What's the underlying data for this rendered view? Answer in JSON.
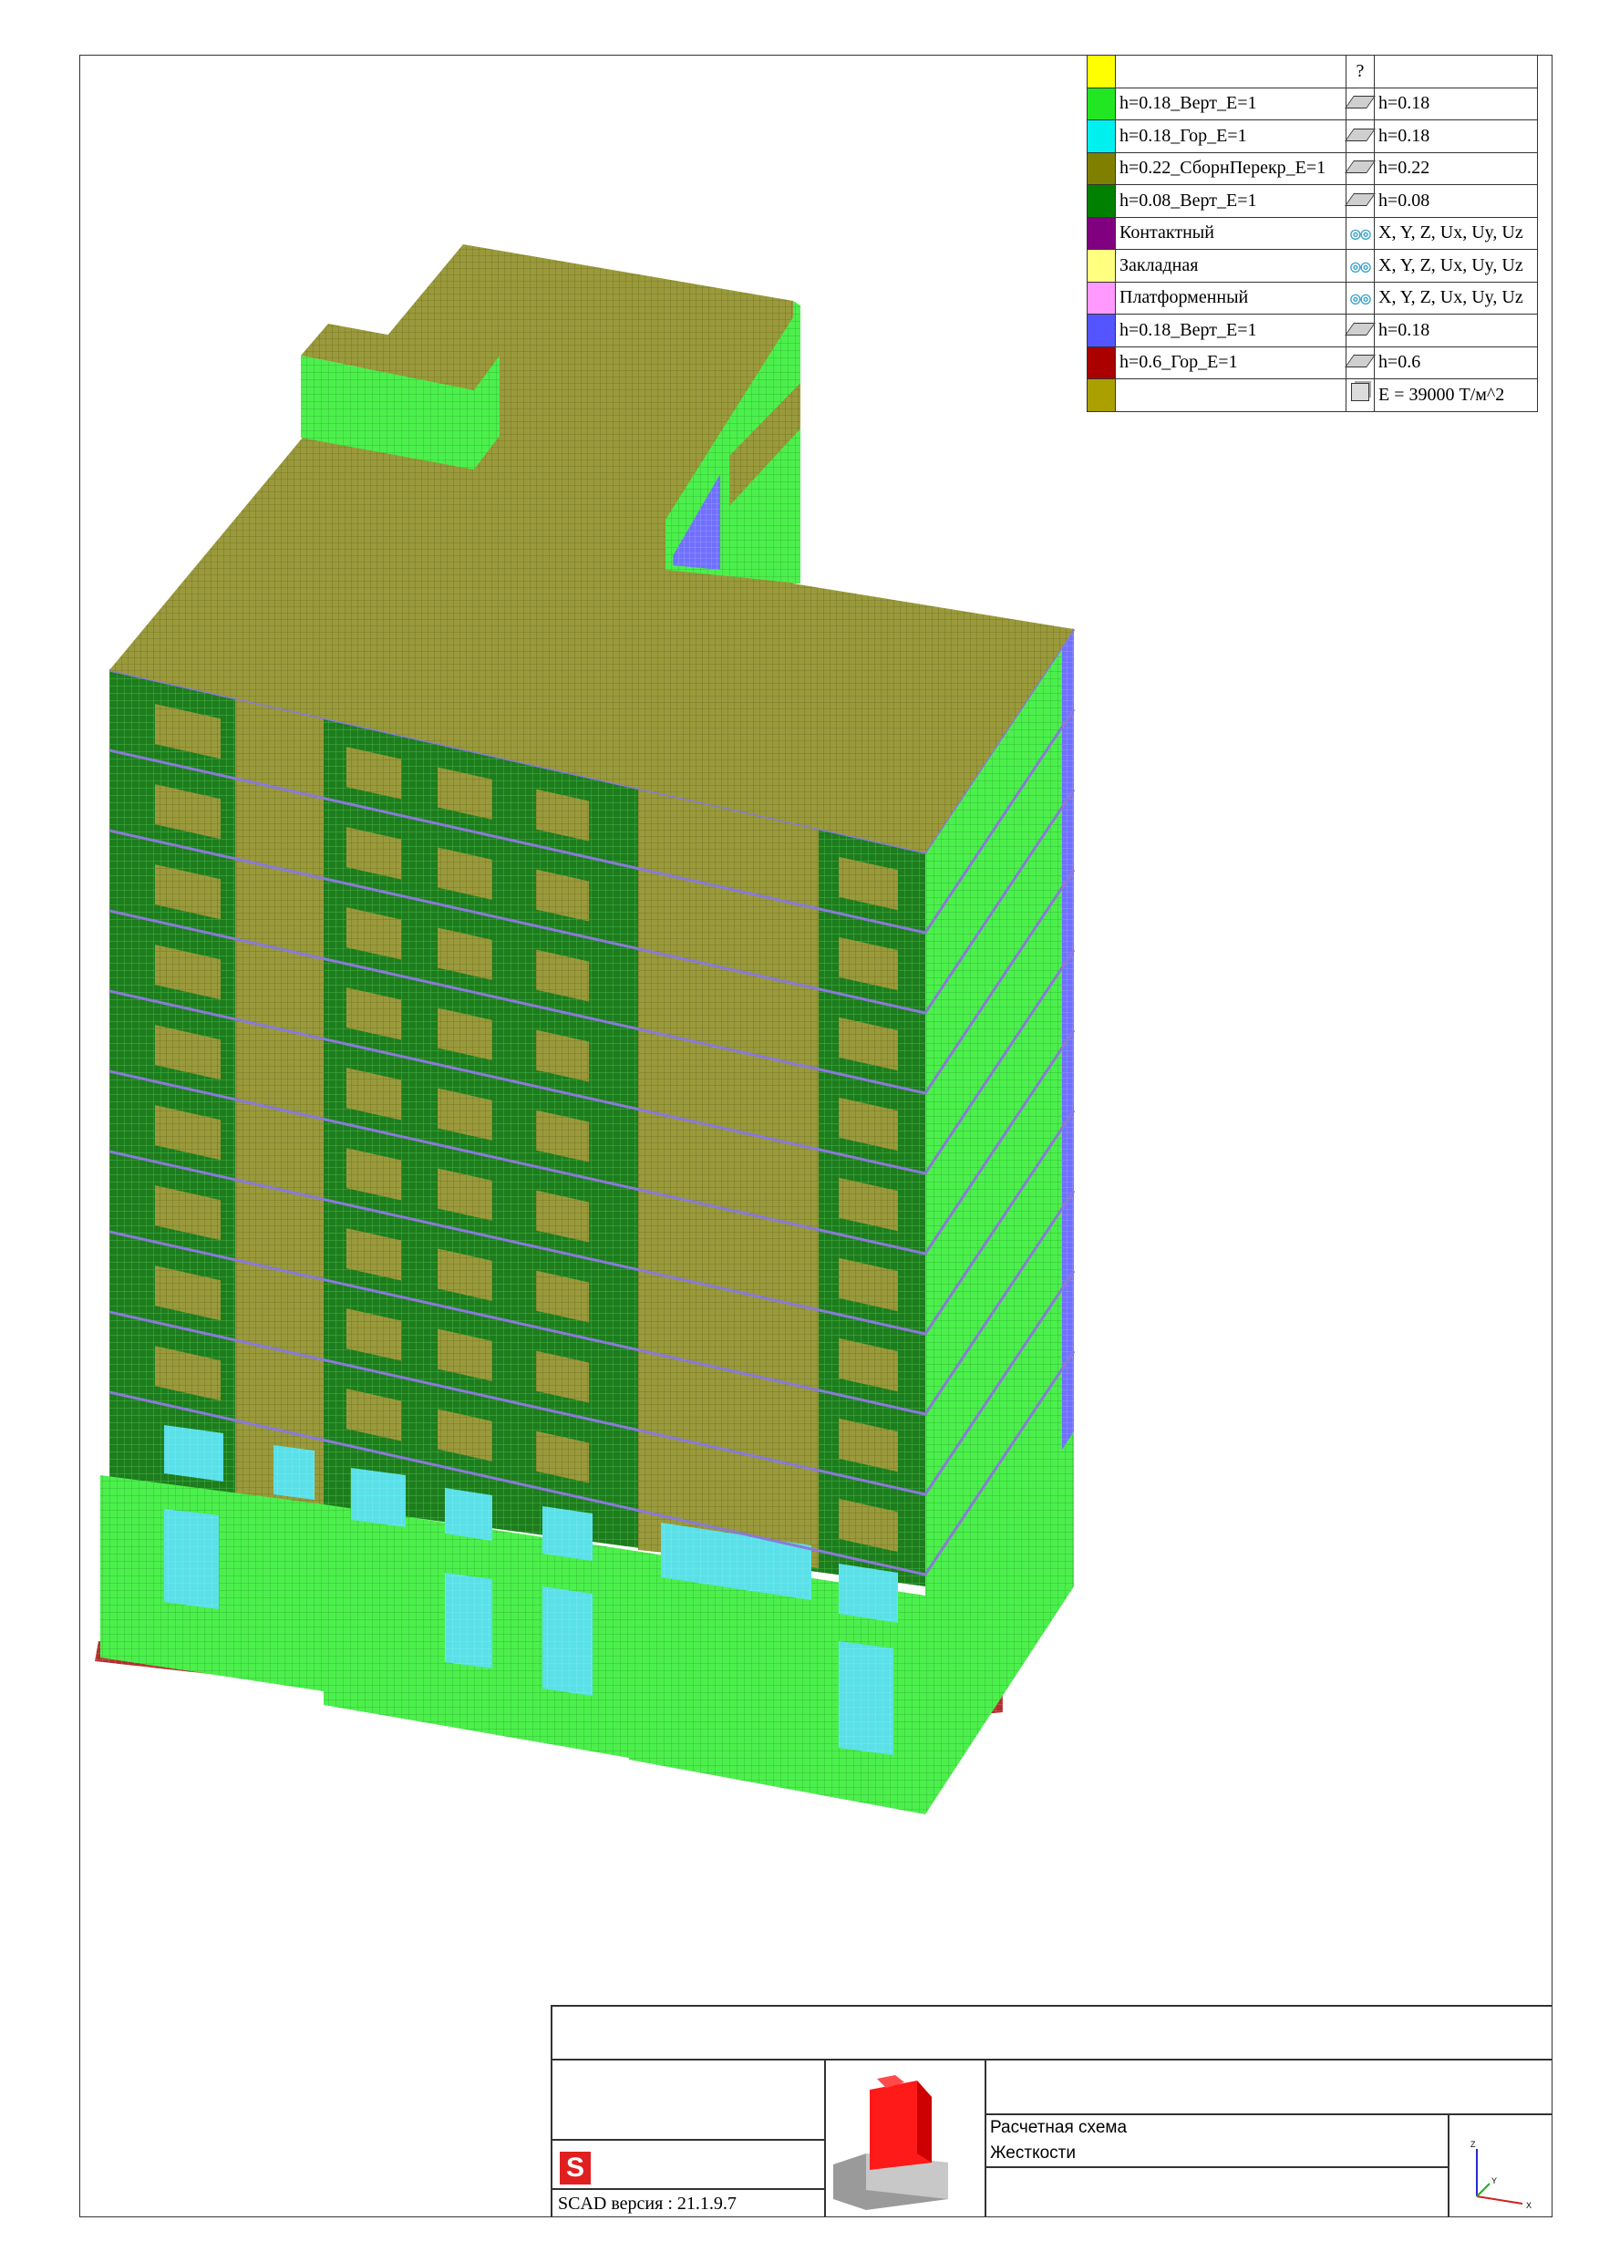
{
  "legend": {
    "header_mark": "?",
    "rows": [
      {
        "color": "#ffff00",
        "name": "",
        "icon": "none",
        "value": ""
      },
      {
        "color": "#22e622",
        "name": "h=0.18_Верт_E=1",
        "icon": "plate-icon",
        "value": "h=0.18"
      },
      {
        "color": "#00f0f0",
        "name": "h=0.18_Гор_E=1",
        "icon": "plate-icon",
        "value": "h=0.18"
      },
      {
        "color": "#808000",
        "name": "h=0.22_СборнПерекр_E=1",
        "icon": "plate-icon",
        "value": "h=0.22"
      },
      {
        "color": "#008000",
        "name": "h=0.08_Верт_E=1",
        "icon": "plate-icon",
        "value": "h=0.08"
      },
      {
        "color": "#800080",
        "name": "Контактный",
        "icon": "link-icon",
        "value": "X, Y, Z, Ux, Uy, Uz"
      },
      {
        "color": "#ffff80",
        "name": "Закладная",
        "icon": "link-icon",
        "value": "X, Y, Z, Ux, Uy, Uz"
      },
      {
        "color": "#ff99ff",
        "name": "Платформенный",
        "icon": "link-icon",
        "value": "X, Y, Z, Ux, Uy, Uz"
      },
      {
        "color": "#5555ff",
        "name": "h=0.18_Верт_E=1",
        "icon": "plate-icon",
        "value": "h=0.18"
      },
      {
        "color": "#aa0000",
        "name": "h=0.6_Гор_E=1",
        "icon": "plate-icon",
        "value": "h=0.6"
      },
      {
        "color": "#aaa000",
        "name": "",
        "icon": "solid-icon",
        "value": "E = 39000 Т/м^2"
      }
    ]
  },
  "title_block": {
    "line1": "Расчетная схема",
    "line2": "Жесткости",
    "version": "SCAD версия : 21.1.9.7",
    "logo_letter": "S",
    "axes": {
      "x": "X",
      "y": "Y",
      "z": "Z"
    }
  },
  "colors": {
    "roof": "#9a9a3c",
    "wall_light": "#4cf04c",
    "wall_dark": "#1d7d1d",
    "glass": "#5ae0e8",
    "edge_blue": "#7070ff",
    "base_red": "#b03030"
  }
}
